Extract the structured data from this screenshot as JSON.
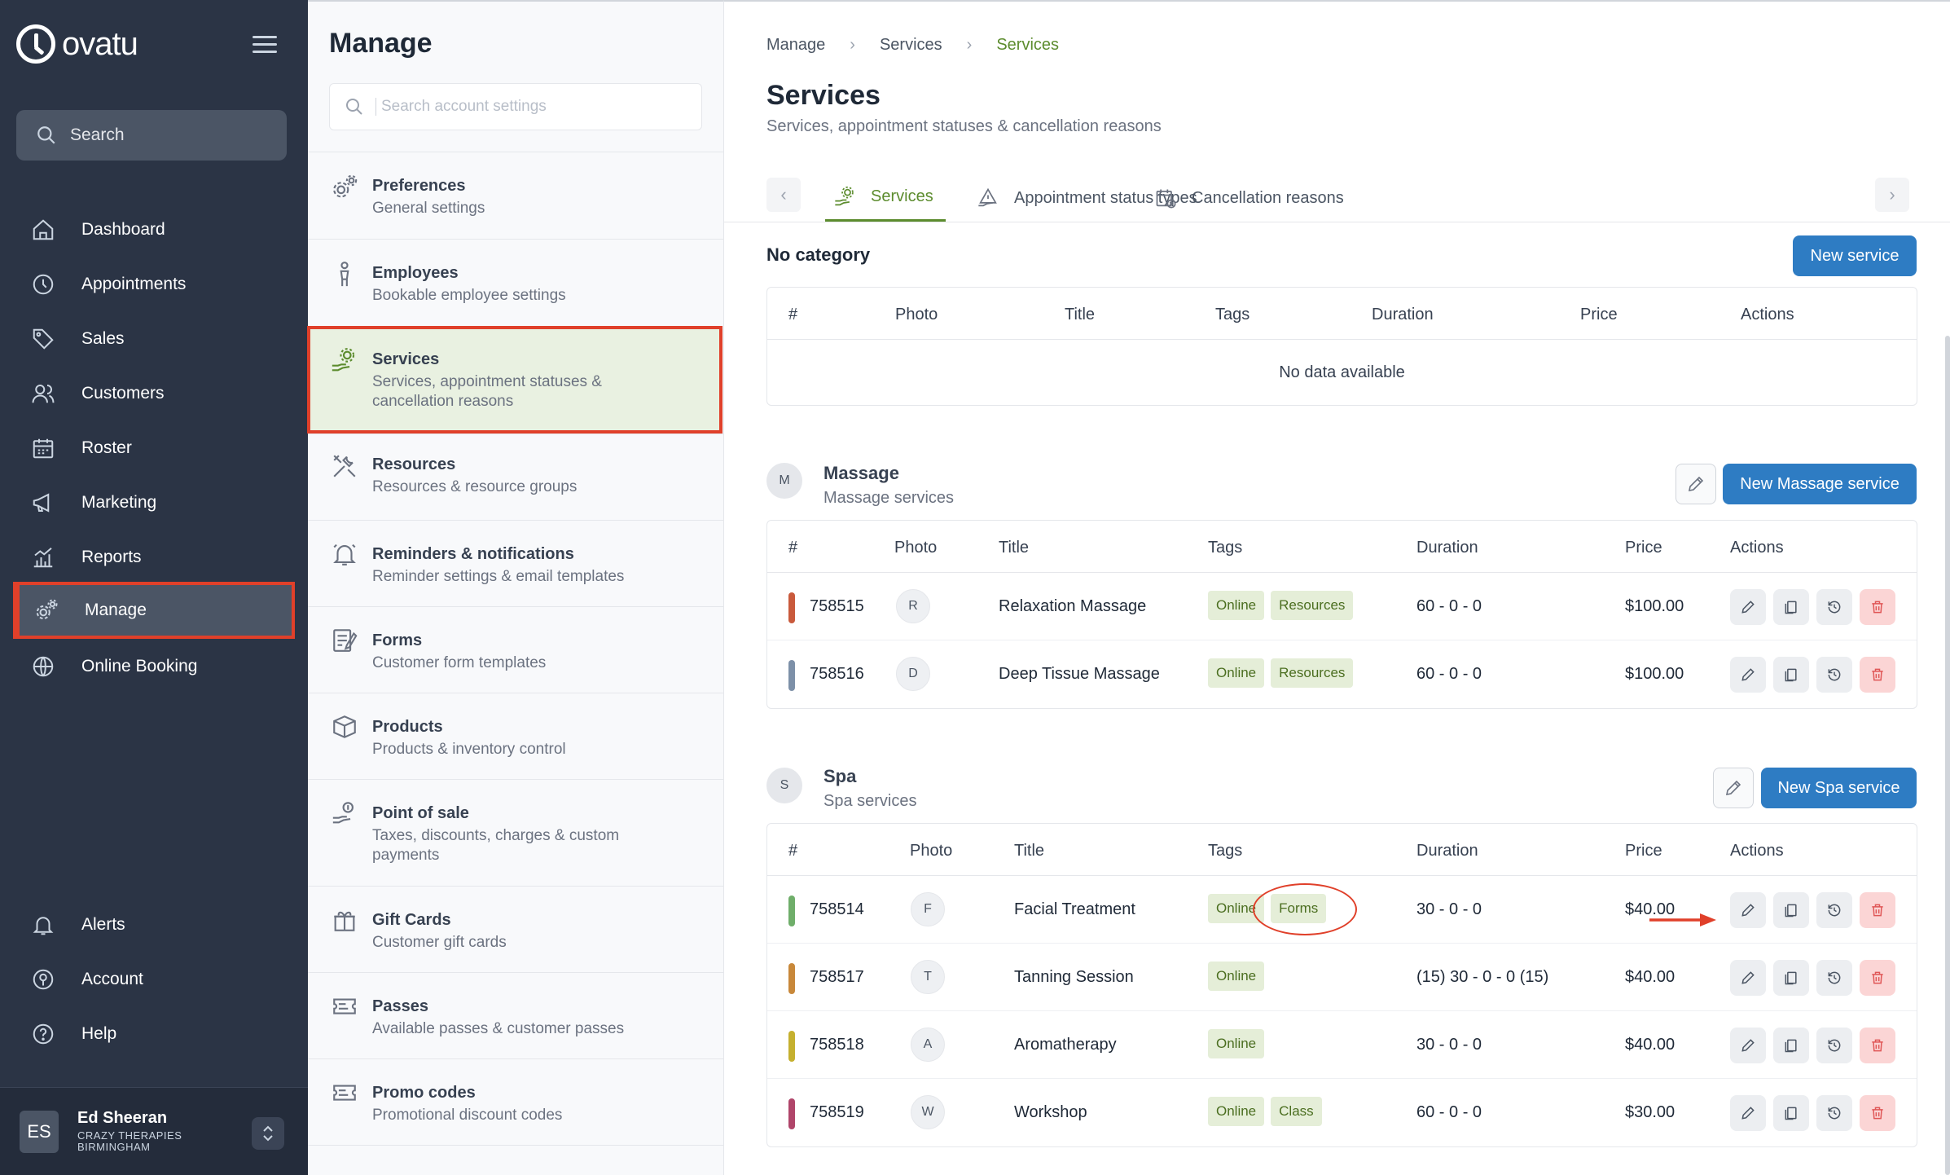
{
  "app": {
    "logo_text": "ovatu"
  },
  "nav": {
    "search_label": "Search",
    "items": [
      {
        "label": "Dashboard",
        "icon": "home-icon"
      },
      {
        "label": "Appointments",
        "icon": "clock-icon"
      },
      {
        "label": "Sales",
        "icon": "tag-icon"
      },
      {
        "label": "Customers",
        "icon": "users-icon"
      },
      {
        "label": "Roster",
        "icon": "calendar-icon"
      },
      {
        "label": "Marketing",
        "icon": "megaphone-icon"
      },
      {
        "label": "Reports",
        "icon": "bar-chart-icon"
      },
      {
        "label": "Manage",
        "icon": "gears-icon",
        "active": true
      },
      {
        "label": "Online Booking",
        "icon": "globe-icon"
      }
    ],
    "bottom_items": [
      {
        "label": "Alerts",
        "icon": "bell-icon"
      },
      {
        "label": "Account",
        "icon": "account-icon"
      },
      {
        "label": "Help",
        "icon": "help-icon"
      }
    ],
    "user": {
      "initials": "ES",
      "name": "Ed Sheeran",
      "company": "CRAZY THERAPIES BIRMINGHAM"
    }
  },
  "settings": {
    "title": "Manage",
    "search_placeholder": "Search account settings",
    "items": [
      {
        "title": "Preferences",
        "sub": "General settings",
        "icon": "gears-icon"
      },
      {
        "title": "Employees",
        "sub": "Bookable employee settings",
        "icon": "person-icon"
      },
      {
        "title": "Services",
        "sub": "Services, appointment statuses & cancellation reasons",
        "icon": "hand-gear-icon",
        "active": true
      },
      {
        "title": "Resources",
        "sub": "Resources & resource groups",
        "icon": "tools-icon"
      },
      {
        "title": "Reminders & notifications",
        "sub": "Reminder settings & email templates",
        "icon": "bell-icon"
      },
      {
        "title": "Forms",
        "sub": "Customer form templates",
        "icon": "form-icon"
      },
      {
        "title": "Products",
        "sub": "Products & inventory control",
        "icon": "box-icon"
      },
      {
        "title": "Point of sale",
        "sub": "Taxes, discounts, charges & custom payments",
        "icon": "pos-icon"
      },
      {
        "title": "Gift Cards",
        "sub": "Customer gift cards",
        "icon": "gift-icon"
      },
      {
        "title": "Passes",
        "sub": "Available passes & customer passes",
        "icon": "ticket-icon"
      },
      {
        "title": "Promo codes",
        "sub": "Promotional discount codes",
        "icon": "ticket-icon"
      }
    ]
  },
  "breadcrumb": [
    "Manage",
    "Services",
    "Services"
  ],
  "page": {
    "title": "Services",
    "subtitle": "Services, appointment statuses & cancellation reasons"
  },
  "tabs": [
    {
      "label": "Services",
      "active": true,
      "icon": "hand-gear-icon"
    },
    {
      "label": "Appointment status types",
      "icon": "alert-hand-icon"
    },
    {
      "label": "Cancellation reasons",
      "icon": "calendar-x-icon"
    }
  ],
  "no_category": {
    "title": "No category",
    "button": "New service",
    "headers": [
      "#",
      "Photo",
      "Title",
      "Tags",
      "Duration",
      "Price",
      "Actions"
    ],
    "empty_text": "No data available"
  },
  "categories": [
    {
      "badge": "M",
      "name": "Massage",
      "desc": "Massage services",
      "button": "New Massage service",
      "headers": [
        "#",
        "Photo",
        "Title",
        "Tags",
        "Duration",
        "Price",
        "Actions"
      ],
      "rows": [
        {
          "id": "758515",
          "photo": "R",
          "title": "Relaxation Massage",
          "tags": [
            "Online",
            "Resources"
          ],
          "duration": "60 - 0 - 0",
          "price": "$100.00",
          "color": "#c95a3c"
        },
        {
          "id": "758516",
          "photo": "D",
          "title": "Deep Tissue Massage",
          "tags": [
            "Online",
            "Resources"
          ],
          "duration": "60 - 0 - 0",
          "price": "$100.00",
          "color": "#7d90a8"
        }
      ]
    },
    {
      "badge": "S",
      "name": "Spa",
      "desc": "Spa services",
      "button": "New Spa service",
      "headers": [
        "#",
        "Photo",
        "Title",
        "Tags",
        "Duration",
        "Price",
        "Actions"
      ],
      "rows": [
        {
          "id": "758514",
          "photo": "F",
          "title": "Facial Treatment",
          "tags": [
            "Online",
            "Forms"
          ],
          "duration": "30 - 0 - 0",
          "price": "$40.00",
          "color": "#6fae6a"
        },
        {
          "id": "758517",
          "photo": "T",
          "title": "Tanning Session",
          "tags": [
            "Online"
          ],
          "duration": "(15) 30 - 0 - 0 (15)",
          "price": "$40.00",
          "color": "#c8883a"
        },
        {
          "id": "758518",
          "photo": "A",
          "title": "Aromatherapy",
          "tags": [
            "Online"
          ],
          "duration": "30 - 0 - 0",
          "price": "$40.00",
          "color": "#c5b02f"
        },
        {
          "id": "758519",
          "photo": "W",
          "title": "Workshop",
          "tags": [
            "Online",
            "Class"
          ],
          "duration": "60 - 0 - 0",
          "price": "$30.00",
          "color": "#b0456a"
        }
      ]
    }
  ],
  "colors": {
    "accent_green": "#5c8c2e",
    "primary_blue": "#2e7cc3",
    "highlight_red": "#e0402a",
    "nav_bg": "#2b3445"
  }
}
